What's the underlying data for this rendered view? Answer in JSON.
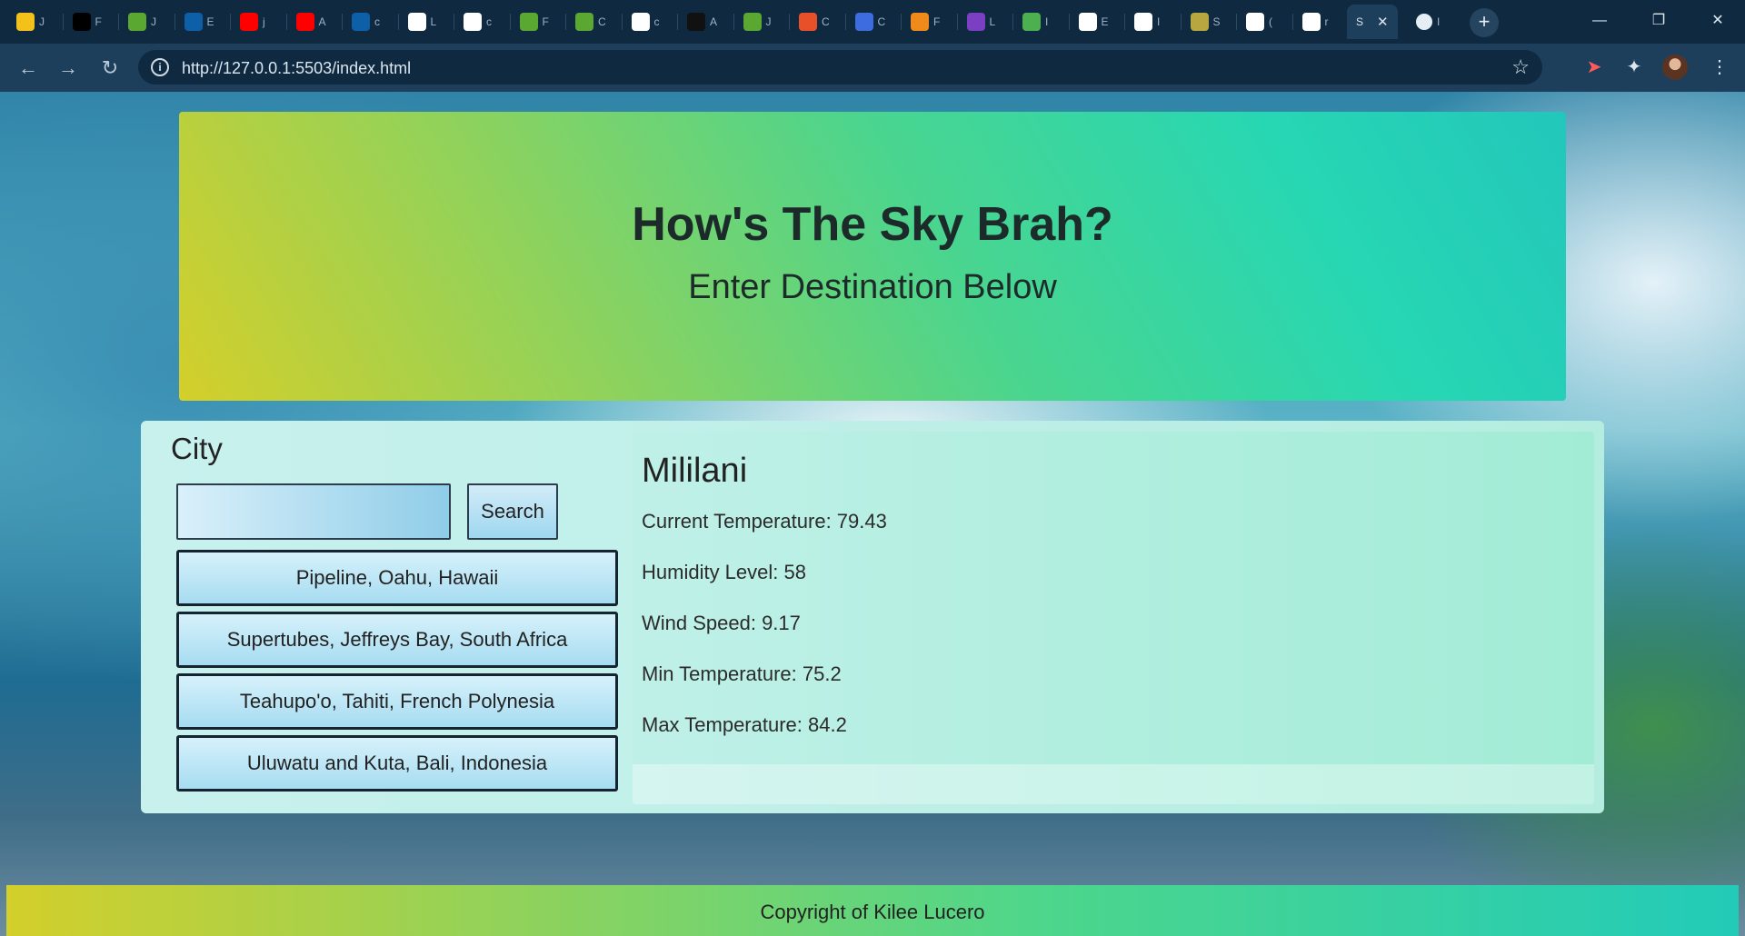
{
  "browser": {
    "tabs": [
      {
        "initial": "J",
        "color": "#f2c21b"
      },
      {
        "initial": "F",
        "color": "#000000"
      },
      {
        "initial": "J",
        "color": "#5aa832"
      },
      {
        "initial": "E",
        "color": "#0d5fa8"
      },
      {
        "initial": "j",
        "color": "#ff0000"
      },
      {
        "initial": "A",
        "color": "#ff0000"
      },
      {
        "initial": "c",
        "color": "#0d5fa8"
      },
      {
        "initial": "L",
        "color": "#ffffff"
      },
      {
        "initial": "c",
        "color": "#ffffff"
      },
      {
        "initial": "F",
        "color": "#5aa832"
      },
      {
        "initial": "C",
        "color": "#5aa832"
      },
      {
        "initial": "c",
        "color": "#ffffff"
      },
      {
        "initial": "A",
        "color": "#111111"
      },
      {
        "initial": "J",
        "color": "#5aa832"
      },
      {
        "initial": "C",
        "color": "#e8502a"
      },
      {
        "initial": "C",
        "color": "#3d6be0"
      },
      {
        "initial": "F",
        "color": "#f08a1a"
      },
      {
        "initial": "L",
        "color": "#7b3fc4"
      },
      {
        "initial": "I",
        "color": "#4caf50"
      },
      {
        "initial": "E",
        "color": "#ffffff"
      },
      {
        "initial": "I",
        "color": "#ffffff"
      },
      {
        "initial": "S",
        "color": "#b8a640"
      },
      {
        "initial": "(",
        "color": "#ffffff"
      },
      {
        "initial": "r",
        "color": "#ffffff"
      }
    ],
    "active_tab_initial": "S",
    "last_tab_initial": "I",
    "new_tab_label": "+",
    "url": "http://127.0.0.1:5503/index.html"
  },
  "hero": {
    "title": "How's The Sky Brah?",
    "subtitle": "Enter Destination Below"
  },
  "search": {
    "label": "City",
    "input_value": "",
    "button_label": "Search"
  },
  "cities": [
    "Pipeline, Oahu, Hawaii",
    "Supertubes, Jeffreys Bay, South Africa",
    "Teahupo'o, Tahiti, French Polynesia",
    "Uluwatu and Kuta, Bali, Indonesia"
  ],
  "weather": {
    "city": "Mililani",
    "current_temp": "Current Temperature: 79.43",
    "humidity": "Humidity Level: 58",
    "wind": "Wind Speed: 9.17",
    "min_temp": "Min Temperature: 75.2",
    "max_temp": "Max Temperature: 84.2"
  },
  "footer": {
    "text": "Copyright of Kilee Lucero"
  }
}
